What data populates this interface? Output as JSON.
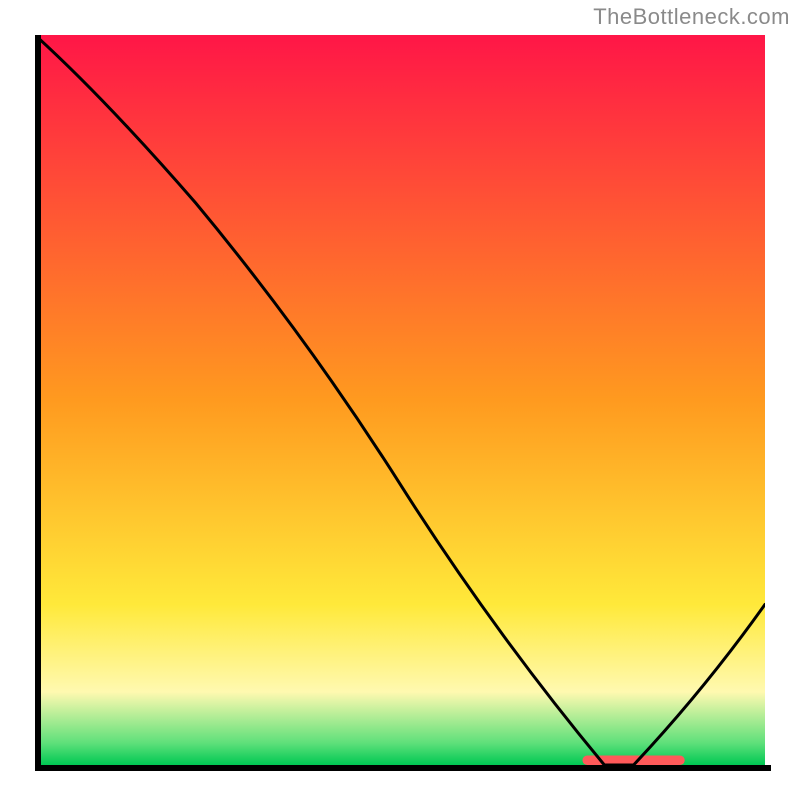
{
  "attribution": "TheBottleneck.com",
  "chart_data": {
    "type": "line",
    "title": "",
    "xlabel": "",
    "ylabel": "",
    "xlim": [
      0,
      100
    ],
    "ylim": [
      0,
      100
    ],
    "x": [
      0,
      22,
      78,
      82,
      100
    ],
    "values": [
      100,
      77,
      0,
      0,
      22
    ],
    "gradient_stops": [
      {
        "offset": 0,
        "color": "#ff1647"
      },
      {
        "offset": 0.5,
        "color": "#ff9a1f"
      },
      {
        "offset": 0.78,
        "color": "#ffe93a"
      },
      {
        "offset": 0.9,
        "color": "#fff9b0"
      },
      {
        "offset": 0.97,
        "color": "#5ee07a"
      },
      {
        "offset": 1.0,
        "color": "#00c853"
      }
    ],
    "highlight_bar": {
      "x0": 75,
      "x1": 89,
      "y": 0,
      "height": 1.3,
      "color": "#ff5a5a"
    }
  }
}
